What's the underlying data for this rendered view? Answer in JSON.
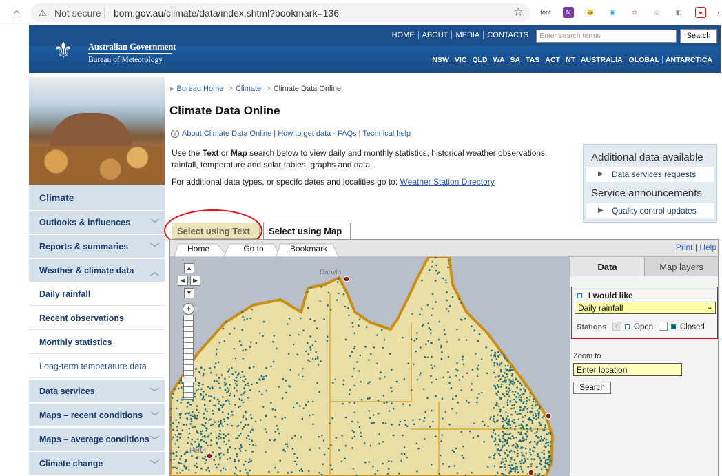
{
  "browser": {
    "security": "Not secure",
    "url": "bom.gov.au/climate/data/index.shtml?bookmark=136",
    "ext_font": "font"
  },
  "header": {
    "gov_name": "Australian Government",
    "bureau_name": "Bureau of Meteorology",
    "top_nav": [
      "HOME",
      "ABOUT",
      "MEDIA",
      "CONTACTS"
    ],
    "search_placeholder": "Enter search terms",
    "search_button": "Search",
    "state_nav": [
      "NSW",
      "VIC",
      "QLD",
      "WA",
      "SA",
      "TAS",
      "ACT",
      "NT",
      "AUSTRALIA",
      "GLOBAL",
      "ANTARCTICA"
    ]
  },
  "sidebar": {
    "title": "Climate",
    "items": [
      {
        "label": "Outlooks & influences",
        "chevron": "﹀"
      },
      {
        "label": "Reports & summaries",
        "chevron": "﹀"
      },
      {
        "label": "Weather & climate data",
        "chevron": "︿"
      }
    ],
    "sub_items": [
      "Daily rainfall",
      "Recent observations",
      "Monthly statistics",
      "Long-term temperature data"
    ],
    "items2": [
      {
        "label": "Data services",
        "chevron": "﹀"
      },
      {
        "label": "Maps – recent conditions",
        "chevron": "﹀"
      },
      {
        "label": "Maps – average conditions",
        "chevron": "﹀"
      },
      {
        "label": "Climate change",
        "chevron": "﹀"
      }
    ]
  },
  "breadcrumb": {
    "home": "Bureau Home",
    "climate": "Climate",
    "current": "Climate Data Online",
    "sep": ">"
  },
  "page_title": "Climate Data Online",
  "info_links": {
    "about": "About Climate Data Online",
    "howto": "How to get data - FAQs",
    "help": "Technical help",
    "sep": " | "
  },
  "intro": {
    "p1_a": "Use the ",
    "p1_text": "Text",
    "p1_b": " or ",
    "p1_map": "Map",
    "p1_c": " search below to view daily and monthly statistics, historical weather observations, rainfall, temperature and solar tables, graphs and data.",
    "p2": "For additional data types, or specifc dates and localities go to: ",
    "p2_link": "Weather Station Directory"
  },
  "right_box": {
    "head1": "Additional data available",
    "link1": "Data services requests",
    "head2": "Service announcements",
    "link2": "Quality control updates"
  },
  "tabs": {
    "text": "Select using Text",
    "map": "Select using Map"
  },
  "map_toolbar": {
    "home": "Home",
    "goto": "Go to",
    "bookmark": "Bookmark",
    "print": "Print",
    "sep": " | ",
    "help": "Help"
  },
  "map": {
    "cities": [
      "Darwin",
      "Perth"
    ]
  },
  "panel": {
    "tab_data": "Data",
    "tab_layers": "Map layers",
    "would_like": "I would like",
    "dataset": "Daily rainfall",
    "stations": "Stations",
    "open": "Open",
    "closed": "Closed",
    "zoom_to": "Zoom to",
    "location_value": "Enter location",
    "search_button": "Search"
  },
  "colors": {
    "header_blue": "#1c4f8c",
    "sidebar_bg": "#d6e0ea",
    "land": "#e9dfa6",
    "station_dot": "#2b6e78",
    "highlight_red": "#e01010"
  }
}
